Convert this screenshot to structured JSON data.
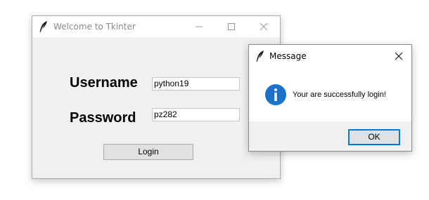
{
  "main_window": {
    "title": "Welcome to Tkinter",
    "icon": "feather-icon",
    "username_label": "Username",
    "username_value": "python19",
    "password_label": "Password",
    "password_value": "pz282",
    "login_label": "Login"
  },
  "message_box": {
    "title": "Message",
    "icon": "info-icon",
    "text": "Your are successfully login!",
    "ok_label": "OK"
  },
  "colors": {
    "window_bg": "#f0f0f0",
    "titlebar_bg": "#ffffff",
    "button_bg": "#e1e1e1",
    "focus_border": "#0078d7",
    "info_icon": "#1a73c9"
  }
}
